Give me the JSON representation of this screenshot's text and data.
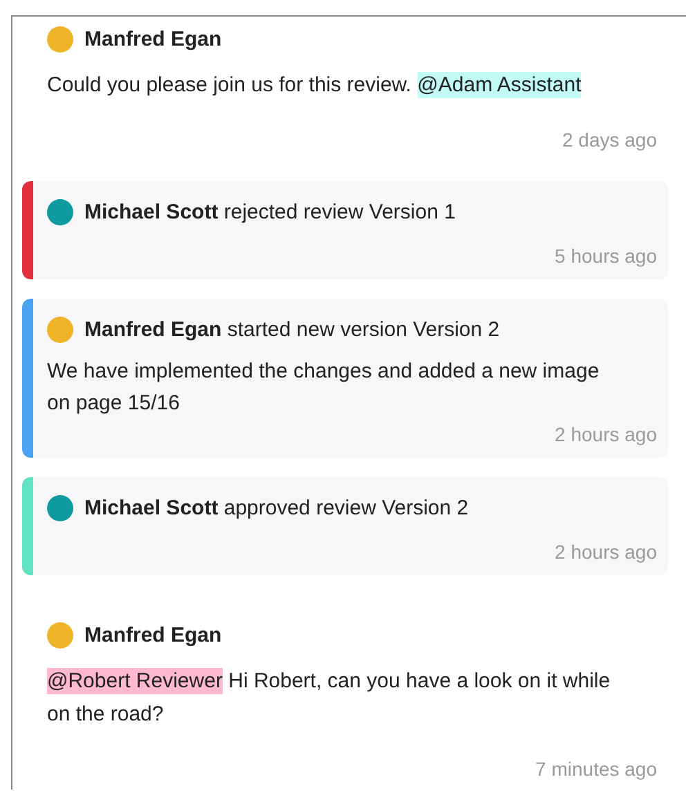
{
  "feed": [
    {
      "kind": "comment",
      "author": "Manfred Egan",
      "avatar": {
        "color": "#f0b429"
      },
      "body": [
        {
          "kind": "text",
          "text": "Could you please join us for this review."
        },
        {
          "kind": "mention",
          "text": "@Adam Assistant",
          "color": "#c2fbf3"
        }
      ],
      "time": "2 days ago"
    },
    {
      "kind": "event",
      "author": "Michael Scott",
      "avatar": {
        "color": "#0f9aa0"
      },
      "action": "rejected review Version 1",
      "color": "#e22d3d",
      "time": "5 hours ago"
    },
    {
      "kind": "event",
      "author": "Manfred Egan",
      "avatar": {
        "color": "#f0b429"
      },
      "action": "started new version Version 2",
      "note": "We have implemented the changes and added a new image on page 15/16",
      "color": "#4aa3f2",
      "time": "2 hours ago"
    },
    {
      "kind": "event",
      "author": "Michael Scott",
      "avatar": {
        "color": "#0f9aa0"
      },
      "action": "approved review Version 2",
      "color": "#62e3c2",
      "time": "2 hours ago"
    },
    {
      "kind": "comment",
      "author": "Manfred Egan",
      "avatar": {
        "color": "#f0b429"
      },
      "body": [
        {
          "kind": "mention",
          "text": "@Robert Reviewer",
          "color": "#ffb8d2"
        },
        {
          "kind": "text",
          "text": "Hi Robert, can you have a look on it while on the road?"
        }
      ],
      "time": "7 minutes ago"
    }
  ]
}
